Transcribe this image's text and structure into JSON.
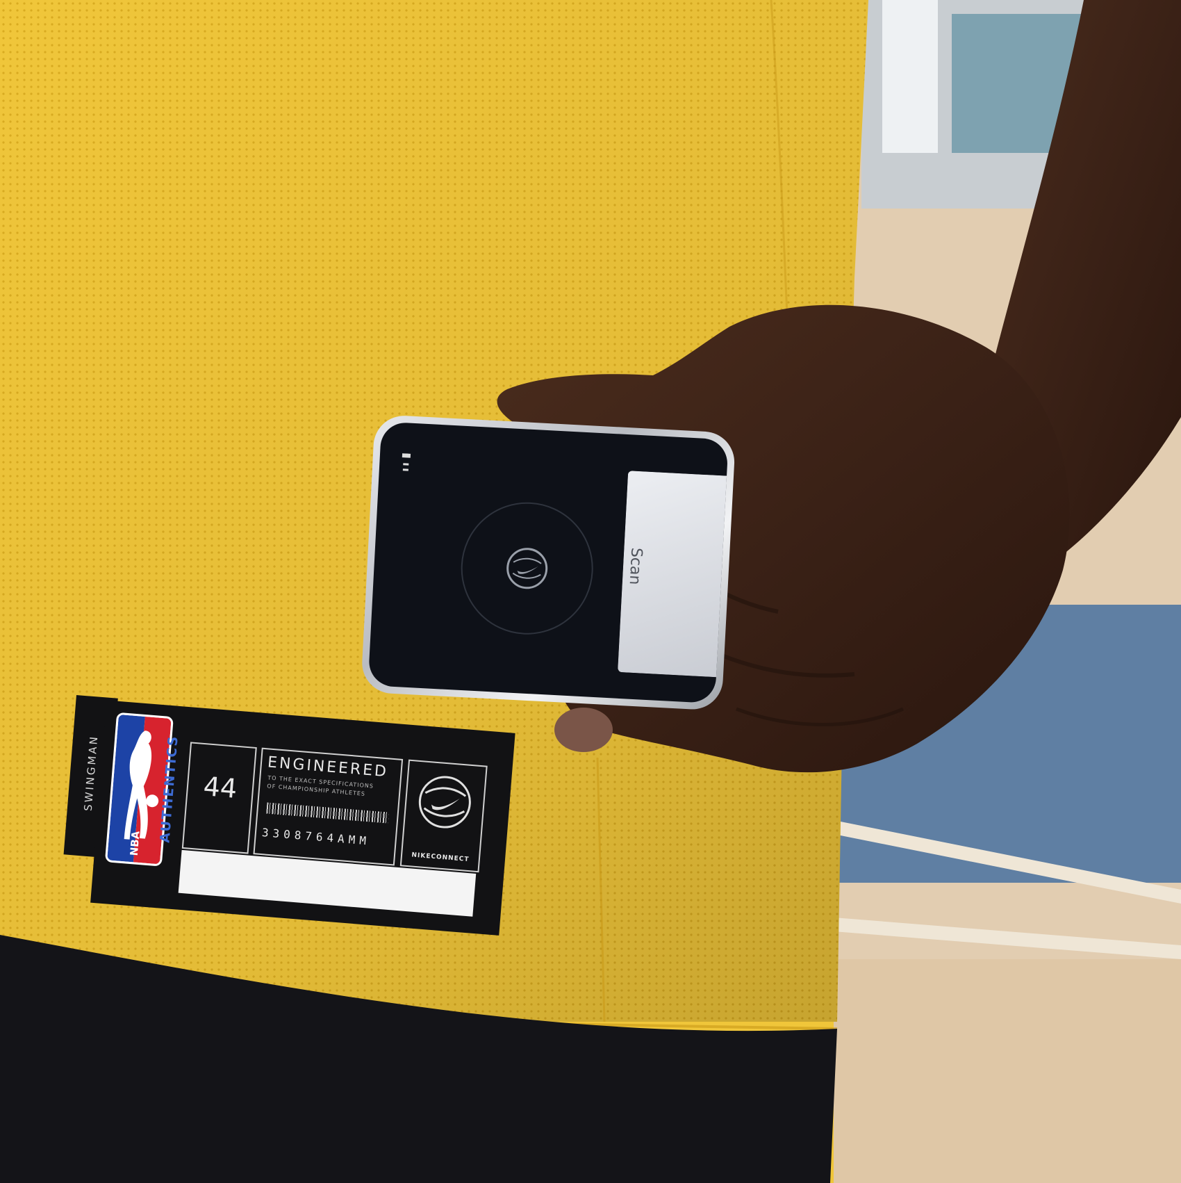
{
  "photo": {
    "description_colors": {
      "jersey": "#f0c63a",
      "skin": "#3a2318",
      "shorts": "#141418",
      "court": "#e6cfae",
      "court_blue": "#5f7fa3"
    }
  },
  "tag": {
    "side_label": "SWINGMAN",
    "logo_text": "NBA",
    "authentics": "AUTHENTICS",
    "size": "44",
    "engineered_title": "ENGINEERED",
    "engineered_sub1": "TO THE EXACT SPECIFICATIONS",
    "engineered_sub2": "OF CHAMPIONSHIP ATHLETES",
    "serial": "3308764AMM",
    "connect_label": "NIKECONNECT"
  },
  "phone": {
    "card_text": "Scan"
  }
}
